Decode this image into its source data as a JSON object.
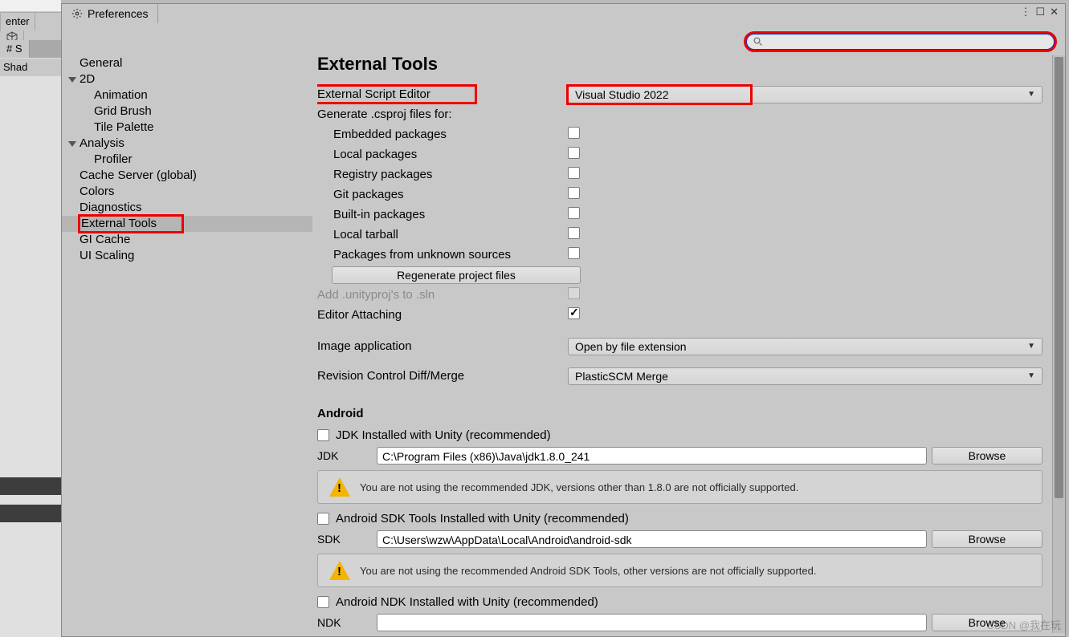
{
  "under": {
    "center": "enter",
    "tab_s": "# S",
    "sub": "Shad"
  },
  "window": {
    "title": "Preferences",
    "search_placeholder": ""
  },
  "sidebar": {
    "items": [
      {
        "label": "General",
        "lvl": 0,
        "group": false
      },
      {
        "label": "2D",
        "lvl": 0,
        "group": true
      },
      {
        "label": "Animation",
        "lvl": 1,
        "group": false
      },
      {
        "label": "Grid Brush",
        "lvl": 1,
        "group": false
      },
      {
        "label": "Tile Palette",
        "lvl": 1,
        "group": false
      },
      {
        "label": "Analysis",
        "lvl": 0,
        "group": true
      },
      {
        "label": "Profiler",
        "lvl": 1,
        "group": false
      },
      {
        "label": "Cache Server (global)",
        "lvl": 0,
        "group": false
      },
      {
        "label": "Colors",
        "lvl": 0,
        "group": false
      },
      {
        "label": "Diagnostics",
        "lvl": 0,
        "group": false
      },
      {
        "label": "External Tools",
        "lvl": 0,
        "group": false,
        "selected": true,
        "hl": true
      },
      {
        "label": "GI Cache",
        "lvl": 0,
        "group": false
      },
      {
        "label": "UI Scaling",
        "lvl": 0,
        "group": false
      }
    ]
  },
  "main": {
    "title": "External Tools",
    "ext_editor_label": "External Script Editor",
    "ext_editor_value": "Visual Studio 2022",
    "gen_label": "Generate .csproj files for:",
    "gen_items": [
      "Embedded packages",
      "Local packages",
      "Registry packages",
      "Git packages",
      "Built-in packages",
      "Local tarball",
      "Packages from unknown sources"
    ],
    "regen_btn": "Regenerate project files",
    "add_sln": "Add .unityproj's to .sln",
    "attach": "Editor Attaching",
    "image_app_label": "Image application",
    "image_app_value": "Open by file extension",
    "rev_label": "Revision Control Diff/Merge",
    "rev_value": "PlasticSCM Merge",
    "android": {
      "title": "Android",
      "jdk_chk": "JDK Installed with Unity (recommended)",
      "jdk_lbl": "JDK",
      "jdk_path": "C:\\Program Files (x86)\\Java\\jdk1.8.0_241",
      "jdk_warn": "You are not using the recommended JDK, versions other than 1.8.0 are not officially supported.",
      "sdk_chk": "Android SDK Tools Installed with Unity (recommended)",
      "sdk_lbl": "SDK",
      "sdk_path": "C:\\Users\\wzw\\AppData\\Local\\Android\\android-sdk",
      "sdk_warn": "You are not using the recommended Android SDK Tools, other versions are not officially supported.",
      "ndk_chk": "Android NDK Installed with Unity (recommended)",
      "ndk_lbl": "NDK",
      "browse": "Browse"
    }
  },
  "watermark": "CSDN @我在玩"
}
